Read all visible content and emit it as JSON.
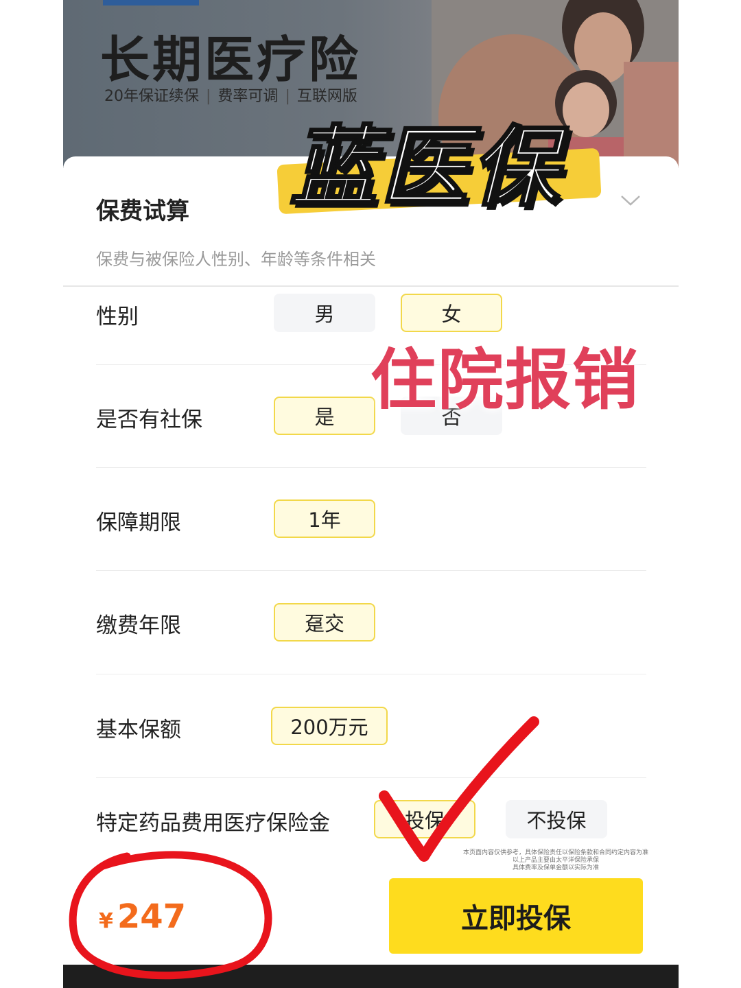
{
  "banner": {
    "title": "长期医疗险",
    "features": [
      "20年保证续保",
      "费率可调",
      "互联网版"
    ]
  },
  "form": {
    "title": "保费试算",
    "subtitle": "保费与被保险人性别、年龄等条件相关",
    "rows": [
      {
        "label": "性别",
        "options": [
          {
            "label": "男",
            "selected": false
          },
          {
            "label": "女",
            "selected": true
          }
        ]
      },
      {
        "label": "是否有社保",
        "options": [
          {
            "label": "是",
            "selected": true
          },
          {
            "label": "否",
            "selected": false
          }
        ]
      },
      {
        "label": "保障期限",
        "options": [
          {
            "label": "1年",
            "selected": true
          }
        ]
      },
      {
        "label": "缴费年限",
        "options": [
          {
            "label": "趸交",
            "selected": true
          }
        ]
      },
      {
        "label": "基本保额",
        "options": [
          {
            "label": "200万元",
            "selected": true
          }
        ]
      },
      {
        "label": "特定药品费用医疗保险金",
        "options": [
          {
            "label": "投保",
            "selected": true
          },
          {
            "label": "不投保",
            "selected": false
          }
        ]
      }
    ]
  },
  "disclaimer": [
    "本页面内容仅供参考，具体保险责任以保险条款和合同约定内容为准",
    "以上产品主要由太平洋保险承保",
    "具体费率及保单金额以实际为准"
  ],
  "bottom_bar": {
    "currency_symbol": "¥",
    "price": "247",
    "buy_label": "立即投保"
  },
  "overlay": {
    "brand_text": "蓝医保",
    "tag_text": "住院报销"
  },
  "colors": {
    "accent_yellow": "#fedc1e",
    "selected_border": "#f2d84a",
    "selected_fill": "#fffbdf",
    "price_orange": "#f36b1c",
    "overlay_red": "#e0405a",
    "annotation_red": "#e8141c"
  }
}
